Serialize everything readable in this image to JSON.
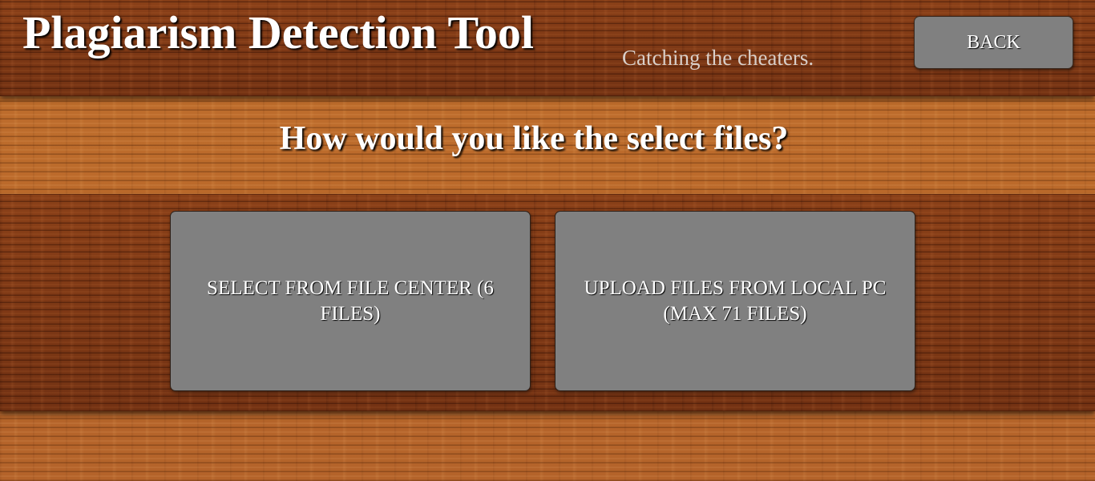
{
  "header": {
    "title": "Plagiarism Detection Tool",
    "subtitle": "Catching the cheaters.",
    "back_label": "BACK"
  },
  "main": {
    "question": "How would you like the select files?",
    "options": [
      {
        "label": "SELECT FROM FILE CENTER (6 FILES)"
      },
      {
        "label": "UPLOAD FILES FROM LOCAL PC (MAX 71 FILES)"
      }
    ]
  },
  "colors": {
    "button_gray": "#808080",
    "wood_light": "#b5682a",
    "wood_dark": "#7a3713",
    "text_white": "#ffffff"
  }
}
